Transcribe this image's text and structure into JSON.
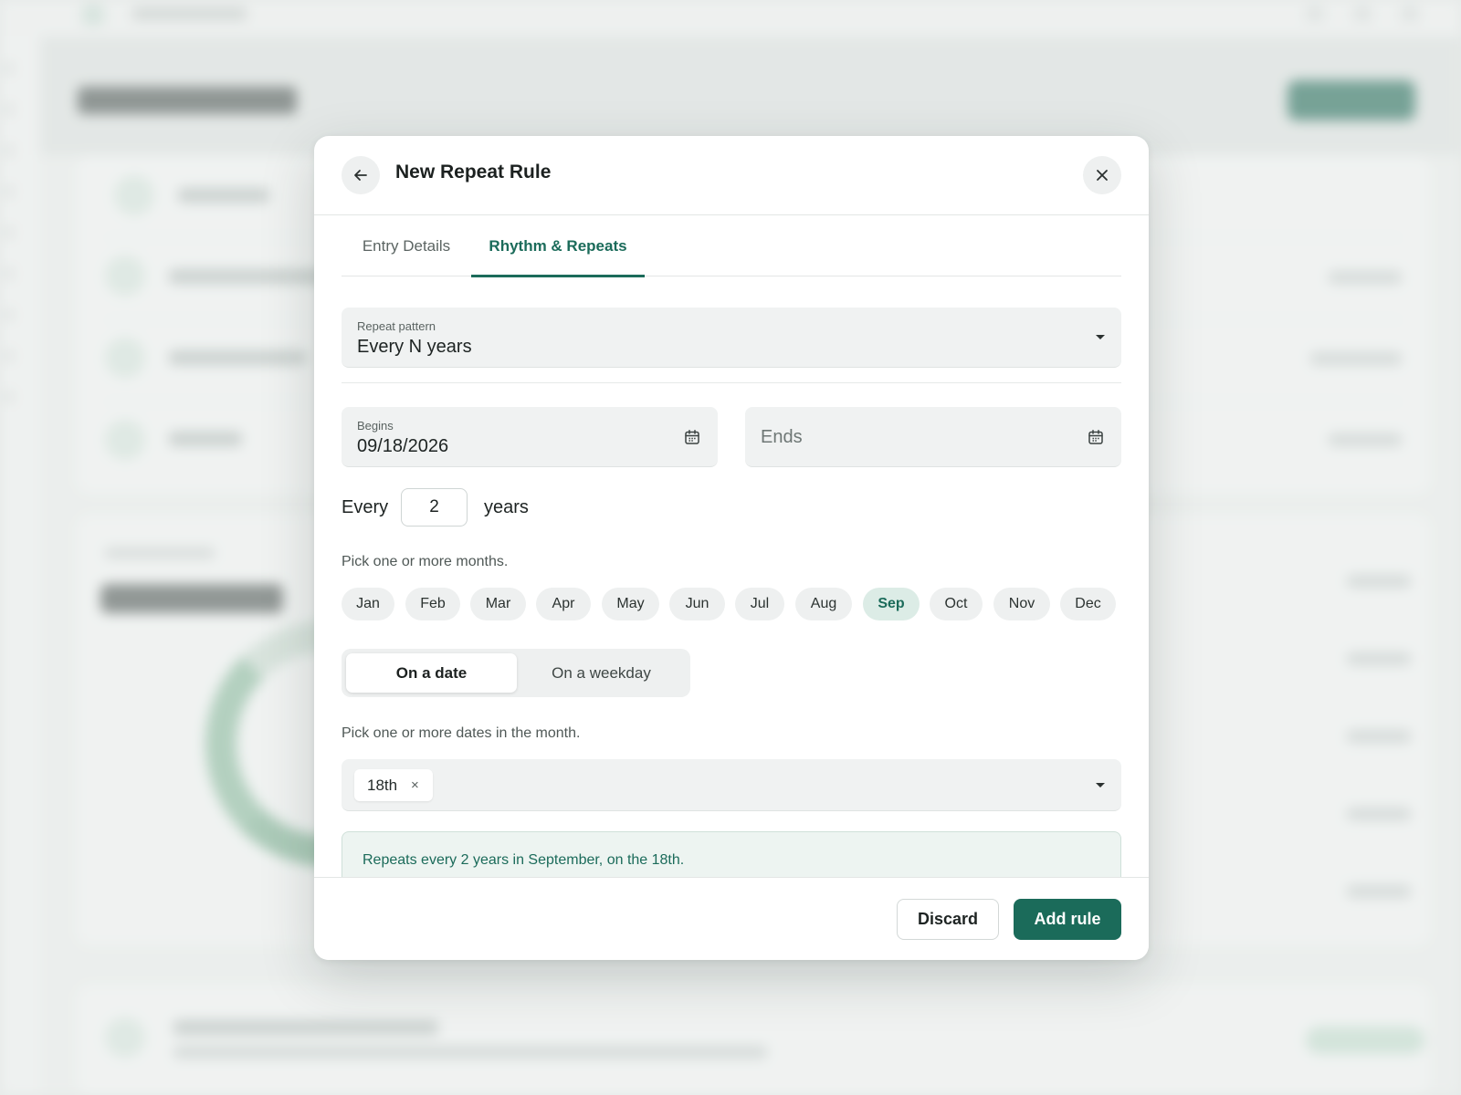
{
  "dialog": {
    "title": "New Repeat Rule",
    "back_icon": "arrow-left-icon",
    "close_icon": "close-icon"
  },
  "tabs": [
    {
      "label": "Entry Details",
      "active": false
    },
    {
      "label": "Rhythm & Repeats",
      "active": true
    }
  ],
  "pattern": {
    "label": "Repeat pattern",
    "value": "Every N years"
  },
  "begins": {
    "label": "Begins",
    "value": "09/18/2026"
  },
  "ends": {
    "placeholder": "Ends"
  },
  "interval": {
    "prefix": "Every",
    "value": "2",
    "suffix": "years"
  },
  "months": {
    "hint": "Pick one or more months.",
    "items": [
      "Jan",
      "Feb",
      "Mar",
      "Apr",
      "May",
      "Jun",
      "Jul",
      "Aug",
      "Sep",
      "Oct",
      "Nov",
      "Dec"
    ],
    "selected": "Sep"
  },
  "mode": {
    "options": [
      "On a date",
      "On a weekday"
    ],
    "active": "On a date"
  },
  "dates": {
    "hint": "Pick one or more dates in the month.",
    "tags": [
      "18th"
    ],
    "remove_glyph": "×"
  },
  "summary": {
    "text": "Repeats every 2 years in September, on the 18th."
  },
  "footer": {
    "discard_label": "Discard",
    "add_label": "Add rule"
  },
  "colors": {
    "accent": "#1b6b5a",
    "selected_chip_bg": "#dcece6",
    "summary_bg": "#edf4f1"
  }
}
